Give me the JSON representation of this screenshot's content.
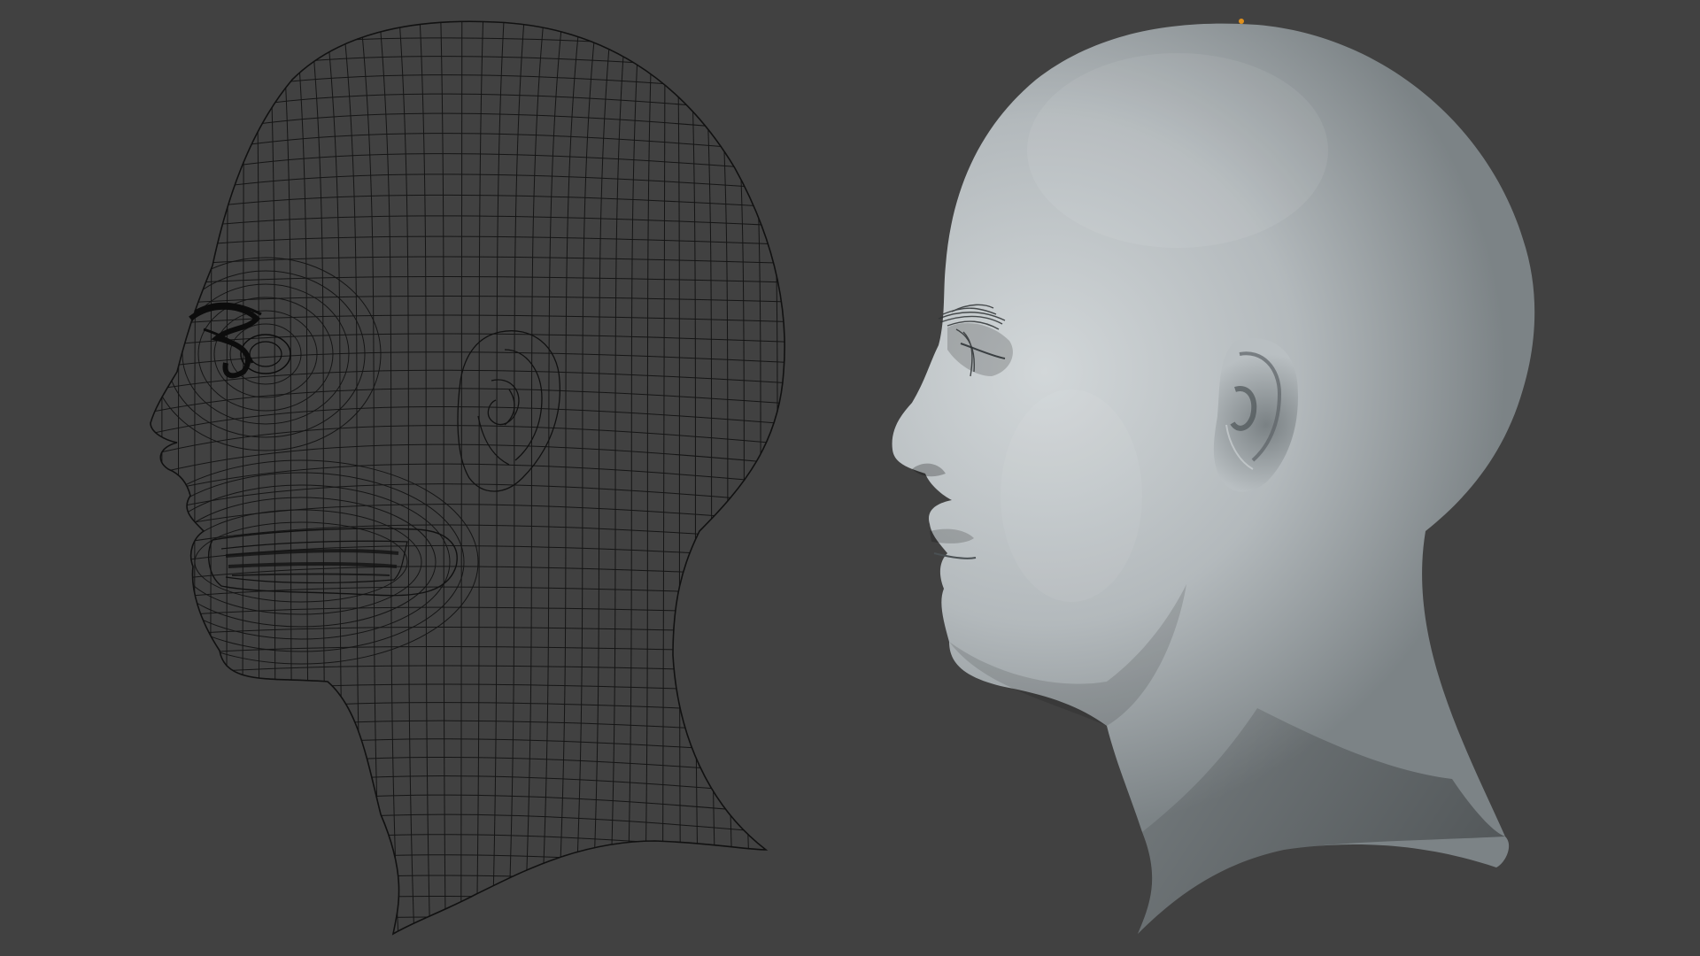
{
  "viewport": {
    "background": "#414141",
    "wire_color": "#111111",
    "skin_light": "#c9ced0",
    "skin_mid": "#9aa1a4",
    "skin_dark": "#5d6366",
    "origin_marker_color": "#e0901c"
  },
  "objects": [
    {
      "name": "head-wireframe",
      "shading": "wireframe"
    },
    {
      "name": "head-solid",
      "shading": "solid"
    }
  ]
}
